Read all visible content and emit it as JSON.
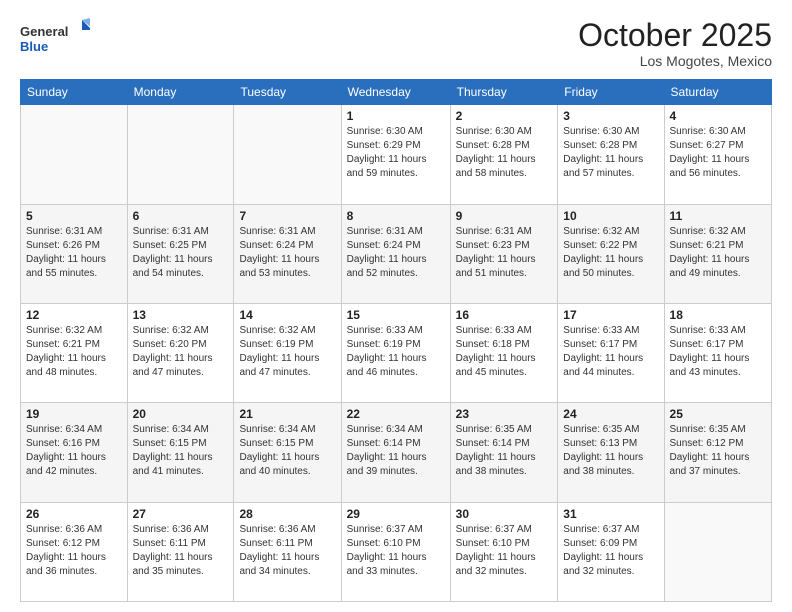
{
  "logo": {
    "general": "General",
    "blue": "Blue"
  },
  "title": "October 2025",
  "location": "Los Mogotes, Mexico",
  "weekdays": [
    "Sunday",
    "Monday",
    "Tuesday",
    "Wednesday",
    "Thursday",
    "Friday",
    "Saturday"
  ],
  "weeks": [
    [
      {
        "day": "",
        "sunrise": "",
        "sunset": "",
        "daylight": ""
      },
      {
        "day": "",
        "sunrise": "",
        "sunset": "",
        "daylight": ""
      },
      {
        "day": "",
        "sunrise": "",
        "sunset": "",
        "daylight": ""
      },
      {
        "day": "1",
        "sunrise": "Sunrise: 6:30 AM",
        "sunset": "Sunset: 6:29 PM",
        "daylight": "Daylight: 11 hours and 59 minutes."
      },
      {
        "day": "2",
        "sunrise": "Sunrise: 6:30 AM",
        "sunset": "Sunset: 6:28 PM",
        "daylight": "Daylight: 11 hours and 58 minutes."
      },
      {
        "day": "3",
        "sunrise": "Sunrise: 6:30 AM",
        "sunset": "Sunset: 6:28 PM",
        "daylight": "Daylight: 11 hours and 57 minutes."
      },
      {
        "day": "4",
        "sunrise": "Sunrise: 6:30 AM",
        "sunset": "Sunset: 6:27 PM",
        "daylight": "Daylight: 11 hours and 56 minutes."
      }
    ],
    [
      {
        "day": "5",
        "sunrise": "Sunrise: 6:31 AM",
        "sunset": "Sunset: 6:26 PM",
        "daylight": "Daylight: 11 hours and 55 minutes."
      },
      {
        "day": "6",
        "sunrise": "Sunrise: 6:31 AM",
        "sunset": "Sunset: 6:25 PM",
        "daylight": "Daylight: 11 hours and 54 minutes."
      },
      {
        "day": "7",
        "sunrise": "Sunrise: 6:31 AM",
        "sunset": "Sunset: 6:24 PM",
        "daylight": "Daylight: 11 hours and 53 minutes."
      },
      {
        "day": "8",
        "sunrise": "Sunrise: 6:31 AM",
        "sunset": "Sunset: 6:24 PM",
        "daylight": "Daylight: 11 hours and 52 minutes."
      },
      {
        "day": "9",
        "sunrise": "Sunrise: 6:31 AM",
        "sunset": "Sunset: 6:23 PM",
        "daylight": "Daylight: 11 hours and 51 minutes."
      },
      {
        "day": "10",
        "sunrise": "Sunrise: 6:32 AM",
        "sunset": "Sunset: 6:22 PM",
        "daylight": "Daylight: 11 hours and 50 minutes."
      },
      {
        "day": "11",
        "sunrise": "Sunrise: 6:32 AM",
        "sunset": "Sunset: 6:21 PM",
        "daylight": "Daylight: 11 hours and 49 minutes."
      }
    ],
    [
      {
        "day": "12",
        "sunrise": "Sunrise: 6:32 AM",
        "sunset": "Sunset: 6:21 PM",
        "daylight": "Daylight: 11 hours and 48 minutes."
      },
      {
        "day": "13",
        "sunrise": "Sunrise: 6:32 AM",
        "sunset": "Sunset: 6:20 PM",
        "daylight": "Daylight: 11 hours and 47 minutes."
      },
      {
        "day": "14",
        "sunrise": "Sunrise: 6:32 AM",
        "sunset": "Sunset: 6:19 PM",
        "daylight": "Daylight: 11 hours and 47 minutes."
      },
      {
        "day": "15",
        "sunrise": "Sunrise: 6:33 AM",
        "sunset": "Sunset: 6:19 PM",
        "daylight": "Daylight: 11 hours and 46 minutes."
      },
      {
        "day": "16",
        "sunrise": "Sunrise: 6:33 AM",
        "sunset": "Sunset: 6:18 PM",
        "daylight": "Daylight: 11 hours and 45 minutes."
      },
      {
        "day": "17",
        "sunrise": "Sunrise: 6:33 AM",
        "sunset": "Sunset: 6:17 PM",
        "daylight": "Daylight: 11 hours and 44 minutes."
      },
      {
        "day": "18",
        "sunrise": "Sunrise: 6:33 AM",
        "sunset": "Sunset: 6:17 PM",
        "daylight": "Daylight: 11 hours and 43 minutes."
      }
    ],
    [
      {
        "day": "19",
        "sunrise": "Sunrise: 6:34 AM",
        "sunset": "Sunset: 6:16 PM",
        "daylight": "Daylight: 11 hours and 42 minutes."
      },
      {
        "day": "20",
        "sunrise": "Sunrise: 6:34 AM",
        "sunset": "Sunset: 6:15 PM",
        "daylight": "Daylight: 11 hours and 41 minutes."
      },
      {
        "day": "21",
        "sunrise": "Sunrise: 6:34 AM",
        "sunset": "Sunset: 6:15 PM",
        "daylight": "Daylight: 11 hours and 40 minutes."
      },
      {
        "day": "22",
        "sunrise": "Sunrise: 6:34 AM",
        "sunset": "Sunset: 6:14 PM",
        "daylight": "Daylight: 11 hours and 39 minutes."
      },
      {
        "day": "23",
        "sunrise": "Sunrise: 6:35 AM",
        "sunset": "Sunset: 6:14 PM",
        "daylight": "Daylight: 11 hours and 38 minutes."
      },
      {
        "day": "24",
        "sunrise": "Sunrise: 6:35 AM",
        "sunset": "Sunset: 6:13 PM",
        "daylight": "Daylight: 11 hours and 38 minutes."
      },
      {
        "day": "25",
        "sunrise": "Sunrise: 6:35 AM",
        "sunset": "Sunset: 6:12 PM",
        "daylight": "Daylight: 11 hours and 37 minutes."
      }
    ],
    [
      {
        "day": "26",
        "sunrise": "Sunrise: 6:36 AM",
        "sunset": "Sunset: 6:12 PM",
        "daylight": "Daylight: 11 hours and 36 minutes."
      },
      {
        "day": "27",
        "sunrise": "Sunrise: 6:36 AM",
        "sunset": "Sunset: 6:11 PM",
        "daylight": "Daylight: 11 hours and 35 minutes."
      },
      {
        "day": "28",
        "sunrise": "Sunrise: 6:36 AM",
        "sunset": "Sunset: 6:11 PM",
        "daylight": "Daylight: 11 hours and 34 minutes."
      },
      {
        "day": "29",
        "sunrise": "Sunrise: 6:37 AM",
        "sunset": "Sunset: 6:10 PM",
        "daylight": "Daylight: 11 hours and 33 minutes."
      },
      {
        "day": "30",
        "sunrise": "Sunrise: 6:37 AM",
        "sunset": "Sunset: 6:10 PM",
        "daylight": "Daylight: 11 hours and 32 minutes."
      },
      {
        "day": "31",
        "sunrise": "Sunrise: 6:37 AM",
        "sunset": "Sunset: 6:09 PM",
        "daylight": "Daylight: 11 hours and 32 minutes."
      },
      {
        "day": "",
        "sunrise": "",
        "sunset": "",
        "daylight": ""
      }
    ]
  ]
}
